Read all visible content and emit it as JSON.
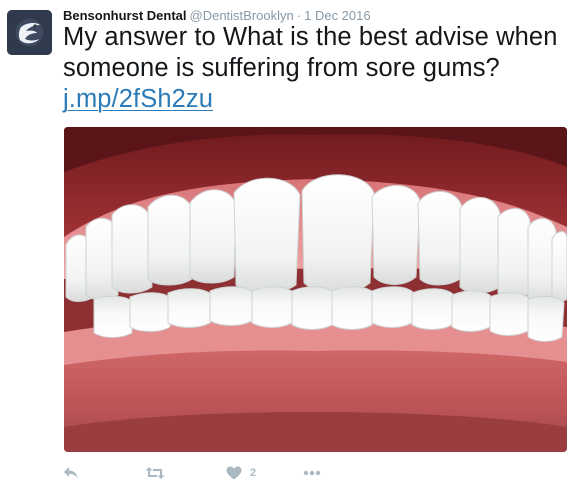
{
  "tweet": {
    "author_name": "Bensonhurst Dental",
    "author_handle": "@DentistBrooklyn",
    "separator": "·",
    "date": "1 Dec 2016",
    "text_main": "My answer to What is the best advise when someone is suffering from sore gums?",
    "link_text": "j.mp/2fSh2zu",
    "media_description_icon": "teeth-photo",
    "like_count": "2"
  },
  "colors": {
    "link": "#2b7bb9",
    "secondary_text": "#8899a6",
    "action_icon": "#aab8c2"
  },
  "icons": {
    "avatar": "logo-avatar-icon",
    "reply": "reply-icon",
    "retweet": "retweet-icon",
    "like": "heart-icon",
    "more": "more-dots-icon"
  }
}
